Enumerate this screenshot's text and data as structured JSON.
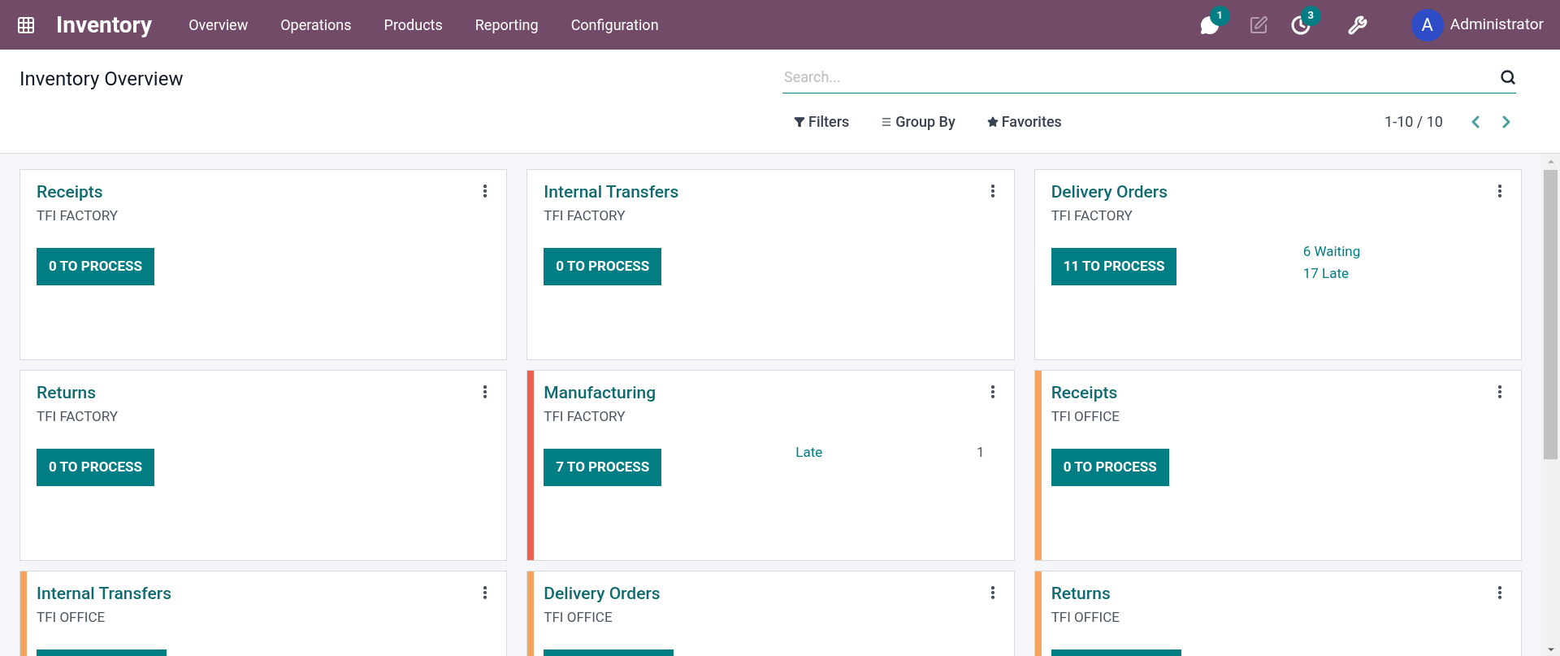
{
  "navbar": {
    "app_name": "Inventory",
    "menu": [
      "Overview",
      "Operations",
      "Products",
      "Reporting",
      "Configuration"
    ],
    "messages_badge": "1",
    "activities_badge": "3",
    "user": {
      "initial": "A",
      "name": "Administrator"
    }
  },
  "control_panel": {
    "title": "Inventory Overview",
    "search": {
      "placeholder": "Search..."
    },
    "filters": [
      {
        "kind": "filter",
        "label": "Filters"
      },
      {
        "kind": "group",
        "label": "Group By"
      },
      {
        "kind": "favorite",
        "label": "Favorites"
      }
    ],
    "pager": "1-10 / 10"
  },
  "cards": [
    {
      "title": "Receipts",
      "warehouse": "TFI FACTORY",
      "action": "0 TO PROCESS"
    },
    {
      "title": "Internal Transfers",
      "warehouse": "TFI FACTORY",
      "action": "0 TO PROCESS"
    },
    {
      "title": "Delivery Orders",
      "warehouse": "TFI FACTORY",
      "action": "11 TO PROCESS",
      "stats": [
        {
          "label": "6 Waiting"
        },
        {
          "label": "17 Late"
        }
      ]
    },
    {
      "title": "Returns",
      "warehouse": "TFI FACTORY",
      "action": "0 TO PROCESS"
    },
    {
      "title": "Manufacturing",
      "warehouse": "TFI FACTORY",
      "color": "#f06050",
      "action": "7 TO PROCESS",
      "stats": [
        {
          "label": "Late",
          "value": "1"
        }
      ]
    },
    {
      "title": "Receipts",
      "warehouse": "TFI OFFICE",
      "color": "#f4a460",
      "action": "0 TO PROCESS"
    },
    {
      "title": "Internal Transfers",
      "warehouse": "TFI OFFICE",
      "color": "#f4a460",
      "action_cut": true
    },
    {
      "title": "Delivery Orders",
      "warehouse": "TFI OFFICE",
      "color": "#f4a460",
      "action_cut": true
    },
    {
      "title": "Returns",
      "warehouse": "TFI OFFICE",
      "color": "#f4a460",
      "action_cut": true
    }
  ]
}
